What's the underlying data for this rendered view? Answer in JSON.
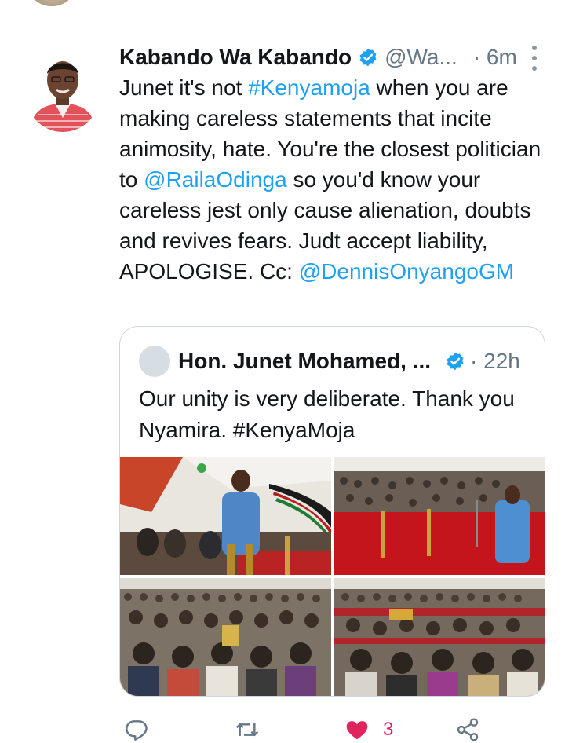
{
  "tweet": {
    "author_name": "Kabando Wa Kabando",
    "author_handle": "@Wa...",
    "time": "· 6m",
    "body": {
      "part1": "Junet it's not ",
      "hashtag": "#Kenyamoja",
      "part2": " when you are making careless statements that incite animosity, hate. You're the closest politician to ",
      "mention1": "@RailaOdinga",
      "part3": " so you'd know your careless jest only cause alienation, doubts and revives fears. Judt accept liability, APOLOGISE. Cc: ",
      "mention2": "@DennisOnyangoGM"
    },
    "like_count": "3"
  },
  "quoted_tweet": {
    "author_name": "Hon. Junet Mohamed, ...",
    "time": "· 22h",
    "text": "Our unity is very deliberate. Thank you Nyamira. #KenyaMoja",
    "photo_count": 4
  },
  "icons": {
    "verified": "verified-badge-icon",
    "more": "more-vertical-icon",
    "reply": "reply-icon",
    "retweet": "retweet-icon",
    "like": "heart-icon",
    "share": "share-icon"
  },
  "colors": {
    "link": "#1da1f2",
    "like": "#e0245e",
    "muted": "#657786",
    "text": "#14171a"
  }
}
